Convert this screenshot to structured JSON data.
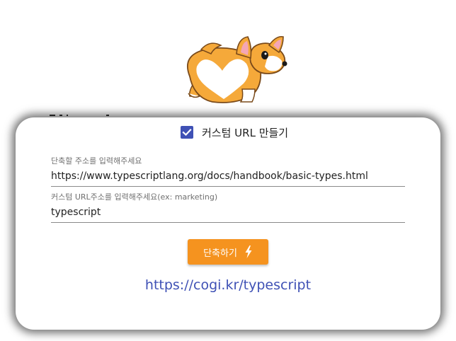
{
  "mascot": {
    "icon": "corgi-icon"
  },
  "custom_url": {
    "checked": true,
    "label": "커스텀 URL 만들기",
    "icon": "check-icon",
    "color": "#3f51b5"
  },
  "original_url": {
    "label": "단축할 주소를 입력해주세요",
    "value": "https://www.typescriptlang.org/docs/handbook/basic-types.html"
  },
  "custom_path": {
    "label": "커스텀 URL주소를 입력해주세요(ex: marketing)",
    "value": "typescript"
  },
  "shorten_button": {
    "label": "단축하기",
    "icon": "lightning-bolt-icon",
    "color": "#f5931f"
  },
  "result": {
    "url": "https://cogi.kr/typescript",
    "color": "#3f51b5"
  }
}
